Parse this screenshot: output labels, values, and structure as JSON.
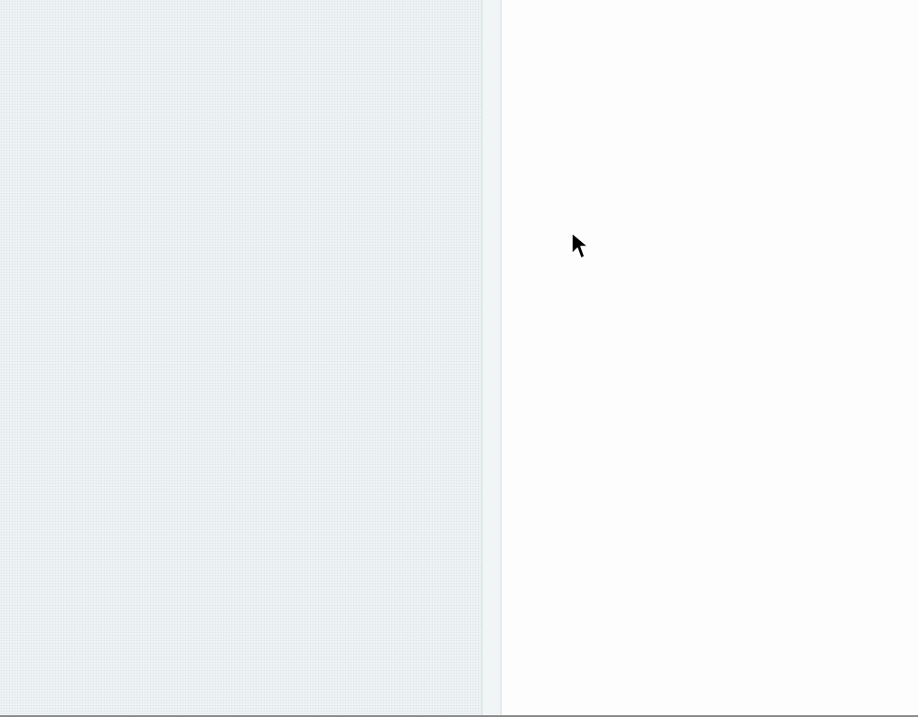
{
  "icons": {
    "pointer": "mouse-pointer-icon"
  },
  "colors": {
    "left_pane": "#eef3f4",
    "divider_border": "#d3dfe1",
    "right_pane": "#fdfdfd",
    "bottom_edge": "#8a8a8a",
    "pointer_fill": "#000000",
    "pointer_outline": "#ffffff"
  }
}
